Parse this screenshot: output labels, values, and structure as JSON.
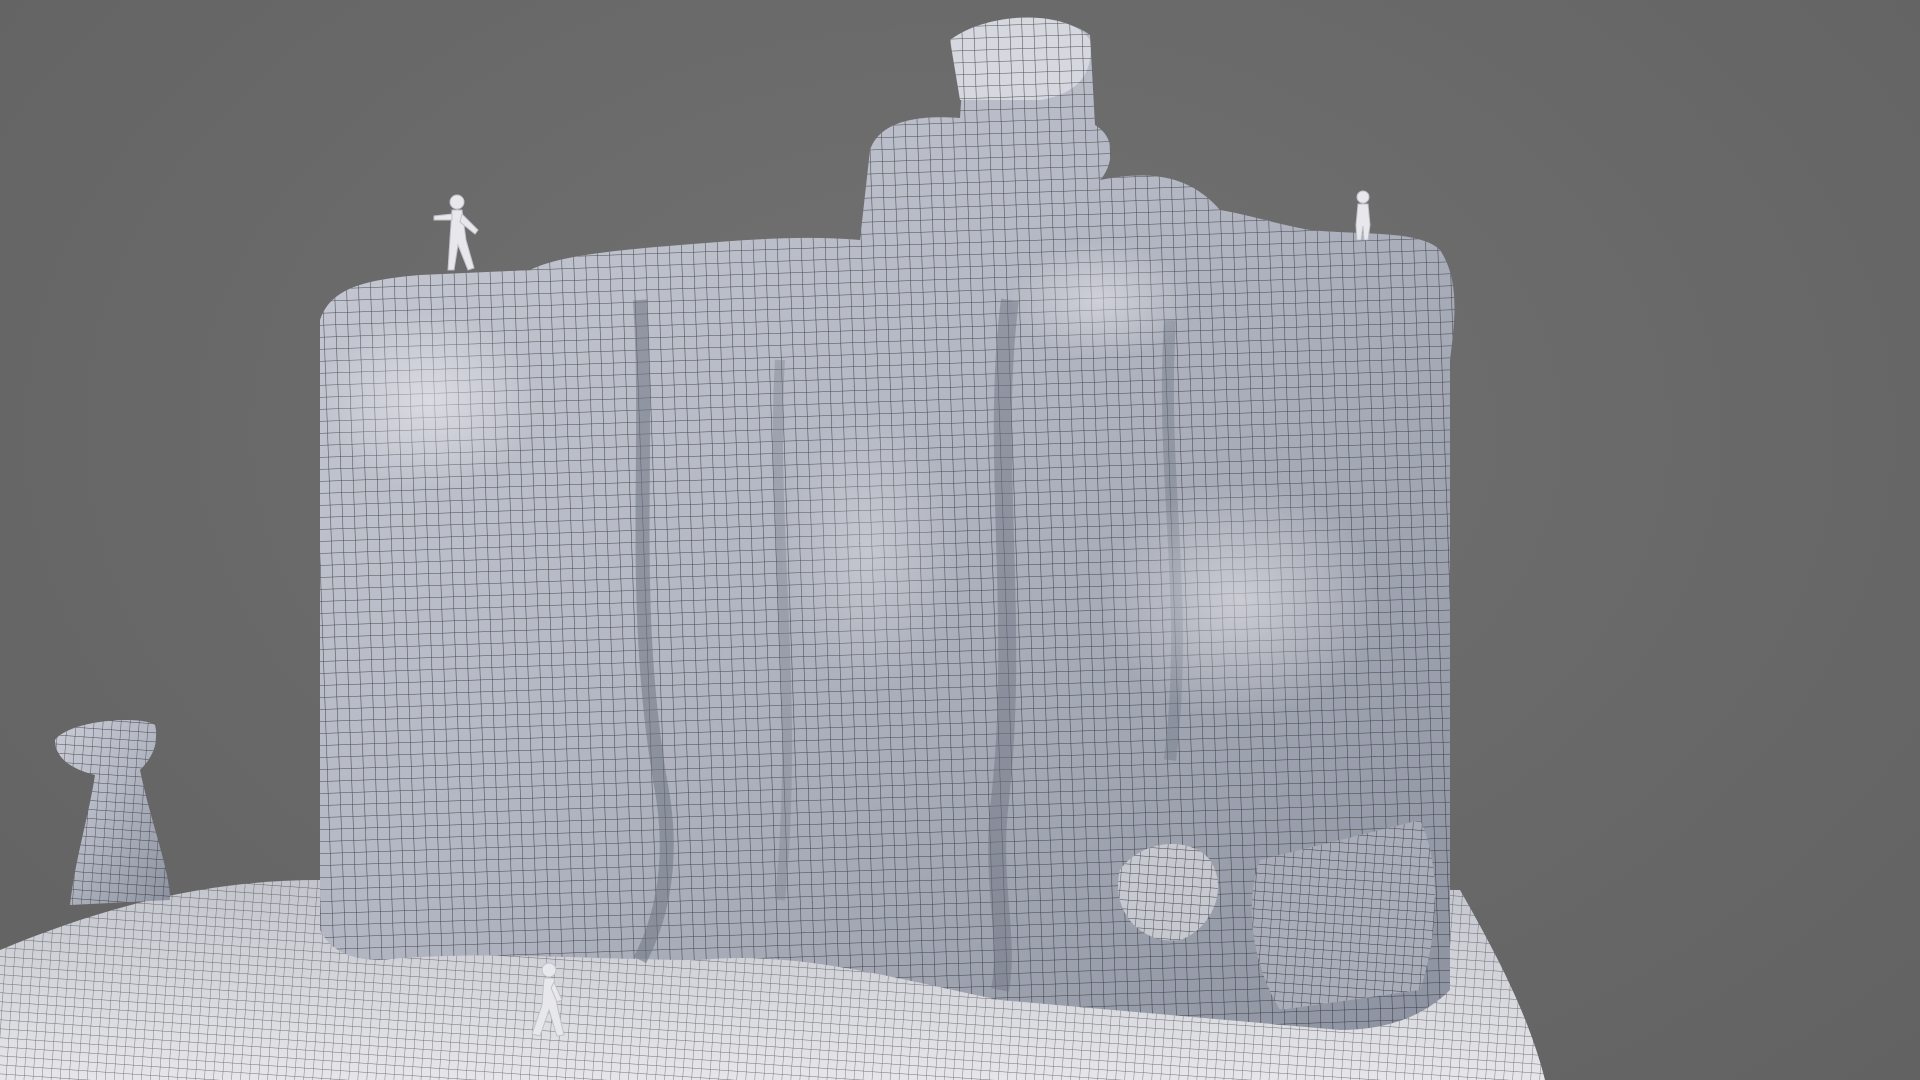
{
  "scene": {
    "background_color": "#6b6b6b",
    "mesh_fill_color": "#d9dbe1",
    "mesh_shadow_color": "#8f93a0",
    "wire_color": "#1a1a1a",
    "subject": "rock-formation-wireframe-render",
    "figures": [
      "human-scale-figure",
      "human-scale-figure",
      "human-scale-figure"
    ]
  }
}
